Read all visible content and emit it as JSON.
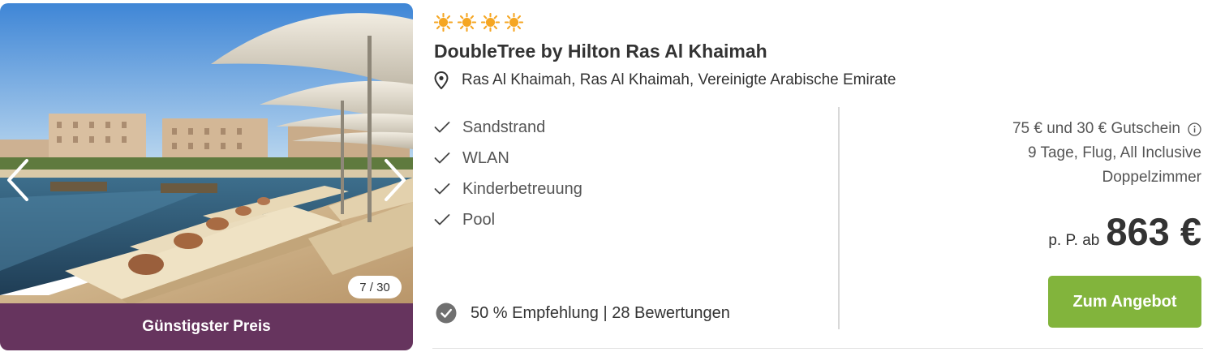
{
  "gallery": {
    "counter": "7 / 30",
    "badge": "Günstigster Preis",
    "image_icon": "pool-with-sunloungers-photo",
    "prev_icon": "chevron-left-icon",
    "next_icon": "chevron-right-icon"
  },
  "hotel": {
    "stars": 4,
    "star_icon": "sun-icon",
    "name": "DoubleTree by Hilton Ras Al Khaimah",
    "location_icon": "location-pin-icon",
    "location": "Ras Al Khaimah, Ras Al Khaimah, Vereinigte Arabische Emirate"
  },
  "features": [
    {
      "label": "Sandstrand",
      "icon": "check-icon"
    },
    {
      "label": "WLAN",
      "icon": "check-icon"
    },
    {
      "label": "Kinderbetreuung",
      "icon": "check-icon"
    },
    {
      "label": "Pool",
      "icon": "check-icon"
    }
  ],
  "rating": {
    "icon": "check-circle-icon",
    "text": "50 % Empfehlung | 28 Bewertungen"
  },
  "offer": {
    "voucher": "75 € und 30 € Gutschein",
    "voucher_icon": "info-icon",
    "details": "9 Tage, Flug, All Inclusive",
    "room": "Doppelzimmer",
    "price_prefix": "p. P. ab",
    "price": "863 €",
    "cta": "Zum Angebot"
  },
  "colors": {
    "ribbon": "#66345e",
    "cta": "#82b43c",
    "star": "#f5a623"
  }
}
